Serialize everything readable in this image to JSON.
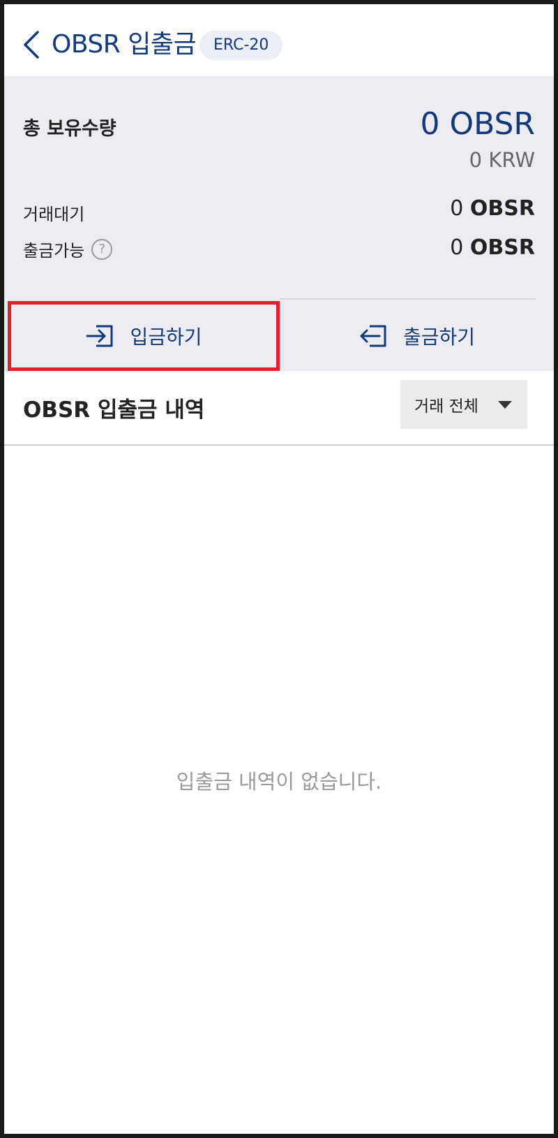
{
  "header": {
    "title": "OBSR 입출금",
    "network_badge": "ERC-20"
  },
  "summary": {
    "total_label": "총 보유수량",
    "total_value": "0 OBSR",
    "total_krw": "0 KRW",
    "pending_label": "거래대기",
    "pending_amount": "0",
    "pending_unit": "OBSR",
    "withdrawable_label": "출금가능",
    "withdrawable_amount": "0",
    "withdrawable_unit": "OBSR",
    "help_glyph": "?"
  },
  "actions": {
    "deposit_label": "입금하기",
    "withdraw_label": "출금하기"
  },
  "history": {
    "title": "OBSR 입출금 내역",
    "filter_selected": "거래 전체",
    "empty_message": "입출금 내역이 없습니다."
  },
  "colors": {
    "brand_navy": "#123a7a",
    "panel_bg": "#ececf2",
    "highlight_red": "#e0202a"
  },
  "icons": {
    "back": "chevron-left-icon",
    "help": "question-circle-icon",
    "deposit": "sign-in-arrow-icon",
    "withdraw": "sign-out-arrow-icon",
    "dropdown": "caret-down-icon"
  }
}
